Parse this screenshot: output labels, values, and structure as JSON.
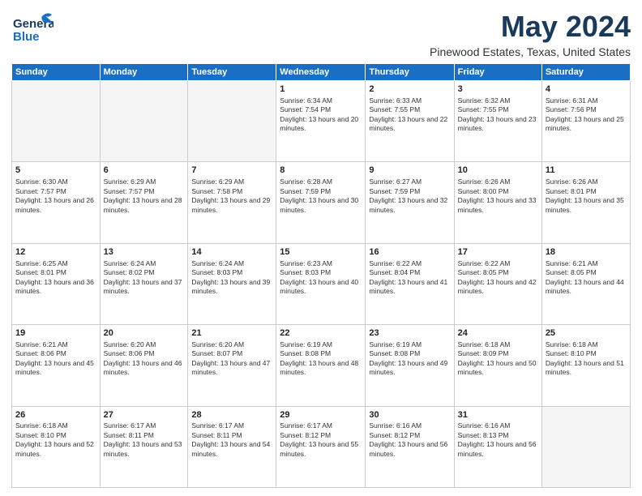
{
  "header": {
    "logo_line1": "General",
    "logo_line2": "Blue",
    "month": "May 2024",
    "location": "Pinewood Estates, Texas, United States"
  },
  "weekdays": [
    "Sunday",
    "Monday",
    "Tuesday",
    "Wednesday",
    "Thursday",
    "Friday",
    "Saturday"
  ],
  "weeks": [
    [
      {
        "day": "",
        "info": ""
      },
      {
        "day": "",
        "info": ""
      },
      {
        "day": "",
        "info": ""
      },
      {
        "day": "1",
        "info": "Sunrise: 6:34 AM\nSunset: 7:54 PM\nDaylight: 13 hours and 20 minutes."
      },
      {
        "day": "2",
        "info": "Sunrise: 6:33 AM\nSunset: 7:55 PM\nDaylight: 13 hours and 22 minutes."
      },
      {
        "day": "3",
        "info": "Sunrise: 6:32 AM\nSunset: 7:55 PM\nDaylight: 13 hours and 23 minutes."
      },
      {
        "day": "4",
        "info": "Sunrise: 6:31 AM\nSunset: 7:56 PM\nDaylight: 13 hours and 25 minutes."
      }
    ],
    [
      {
        "day": "5",
        "info": "Sunrise: 6:30 AM\nSunset: 7:57 PM\nDaylight: 13 hours and 26 minutes."
      },
      {
        "day": "6",
        "info": "Sunrise: 6:29 AM\nSunset: 7:57 PM\nDaylight: 13 hours and 28 minutes."
      },
      {
        "day": "7",
        "info": "Sunrise: 6:29 AM\nSunset: 7:58 PM\nDaylight: 13 hours and 29 minutes."
      },
      {
        "day": "8",
        "info": "Sunrise: 6:28 AM\nSunset: 7:59 PM\nDaylight: 13 hours and 30 minutes."
      },
      {
        "day": "9",
        "info": "Sunrise: 6:27 AM\nSunset: 7:59 PM\nDaylight: 13 hours and 32 minutes."
      },
      {
        "day": "10",
        "info": "Sunrise: 6:26 AM\nSunset: 8:00 PM\nDaylight: 13 hours and 33 minutes."
      },
      {
        "day": "11",
        "info": "Sunrise: 6:26 AM\nSunset: 8:01 PM\nDaylight: 13 hours and 35 minutes."
      }
    ],
    [
      {
        "day": "12",
        "info": "Sunrise: 6:25 AM\nSunset: 8:01 PM\nDaylight: 13 hours and 36 minutes."
      },
      {
        "day": "13",
        "info": "Sunrise: 6:24 AM\nSunset: 8:02 PM\nDaylight: 13 hours and 37 minutes."
      },
      {
        "day": "14",
        "info": "Sunrise: 6:24 AM\nSunset: 8:03 PM\nDaylight: 13 hours and 39 minutes."
      },
      {
        "day": "15",
        "info": "Sunrise: 6:23 AM\nSunset: 8:03 PM\nDaylight: 13 hours and 40 minutes."
      },
      {
        "day": "16",
        "info": "Sunrise: 6:22 AM\nSunset: 8:04 PM\nDaylight: 13 hours and 41 minutes."
      },
      {
        "day": "17",
        "info": "Sunrise: 6:22 AM\nSunset: 8:05 PM\nDaylight: 13 hours and 42 minutes."
      },
      {
        "day": "18",
        "info": "Sunrise: 6:21 AM\nSunset: 8:05 PM\nDaylight: 13 hours and 44 minutes."
      }
    ],
    [
      {
        "day": "19",
        "info": "Sunrise: 6:21 AM\nSunset: 8:06 PM\nDaylight: 13 hours and 45 minutes."
      },
      {
        "day": "20",
        "info": "Sunrise: 6:20 AM\nSunset: 8:06 PM\nDaylight: 13 hours and 46 minutes."
      },
      {
        "day": "21",
        "info": "Sunrise: 6:20 AM\nSunset: 8:07 PM\nDaylight: 13 hours and 47 minutes."
      },
      {
        "day": "22",
        "info": "Sunrise: 6:19 AM\nSunset: 8:08 PM\nDaylight: 13 hours and 48 minutes."
      },
      {
        "day": "23",
        "info": "Sunrise: 6:19 AM\nSunset: 8:08 PM\nDaylight: 13 hours and 49 minutes."
      },
      {
        "day": "24",
        "info": "Sunrise: 6:18 AM\nSunset: 8:09 PM\nDaylight: 13 hours and 50 minutes."
      },
      {
        "day": "25",
        "info": "Sunrise: 6:18 AM\nSunset: 8:10 PM\nDaylight: 13 hours and 51 minutes."
      }
    ],
    [
      {
        "day": "26",
        "info": "Sunrise: 6:18 AM\nSunset: 8:10 PM\nDaylight: 13 hours and 52 minutes."
      },
      {
        "day": "27",
        "info": "Sunrise: 6:17 AM\nSunset: 8:11 PM\nDaylight: 13 hours and 53 minutes."
      },
      {
        "day": "28",
        "info": "Sunrise: 6:17 AM\nSunset: 8:11 PM\nDaylight: 13 hours and 54 minutes."
      },
      {
        "day": "29",
        "info": "Sunrise: 6:17 AM\nSunset: 8:12 PM\nDaylight: 13 hours and 55 minutes."
      },
      {
        "day": "30",
        "info": "Sunrise: 6:16 AM\nSunset: 8:12 PM\nDaylight: 13 hours and 56 minutes."
      },
      {
        "day": "31",
        "info": "Sunrise: 6:16 AM\nSunset: 8:13 PM\nDaylight: 13 hours and 56 minutes."
      },
      {
        "day": "",
        "info": ""
      }
    ]
  ]
}
